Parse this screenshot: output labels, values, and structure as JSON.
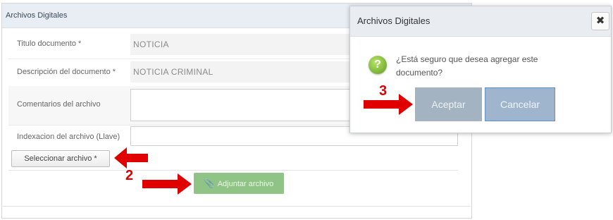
{
  "panel": {
    "title": "Archivos Digitales"
  },
  "form": {
    "rows": [
      {
        "label": "Titulo documento *",
        "value": "NOTICIA"
      },
      {
        "label": "Descripción del documento *",
        "value": "NOTICIA CRIMINAL"
      },
      {
        "label": "Comentarios del archivo",
        "value": ""
      },
      {
        "label": "Indexacion del archivo (Llave)",
        "value": ""
      }
    ],
    "select_file_label": "Seleccionar archivo *",
    "attach_label": "Adjuntar archivo"
  },
  "modal": {
    "title": "Archivos Digitales",
    "close_symbol": "✖",
    "icon_symbol": "?",
    "message": "¿Está seguro que desea agregar este documento?",
    "accept_label": "Aceptar",
    "cancel_label": "Cancelar"
  },
  "annotations": {
    "step2": "2",
    "step3": "3",
    "color": "#e00000"
  },
  "colors": {
    "attach_button": "#8fc486",
    "accept_button": "#a3b3c1",
    "cancel_button": "#9fb5cd",
    "header_bg": "#e8eef4"
  },
  "icons": {
    "close": "close-icon",
    "question": "question-icon",
    "clip": "paperclip-icon",
    "arrow": "arrow-right-icon"
  }
}
